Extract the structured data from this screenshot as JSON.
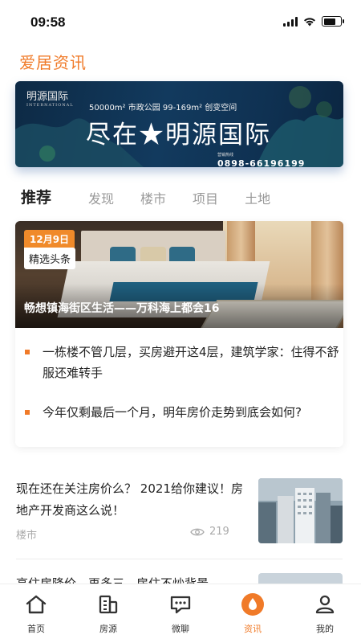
{
  "status": {
    "time": "09:58"
  },
  "header": {
    "title": "爱居资讯"
  },
  "banner": {
    "logo": "明源国际",
    "logo_en": "INTERNATIONAL",
    "sub": "50000m² 市政公园  99-169m² 创变空间",
    "main": "尽在★明源国际",
    "hotline_label": "营销热线",
    "phone": "0898-66196199"
  },
  "tabs": [
    {
      "label": "推荐",
      "active": true
    },
    {
      "label": "发现"
    },
    {
      "label": "楼市"
    },
    {
      "label": "项目"
    },
    {
      "label": "土地"
    }
  ],
  "featured": {
    "date": "12月9日",
    "badge": "精选头条",
    "title": "畅想镇海街区生活——万科海上都会16",
    "headlines": [
      "一栋楼不管几层，买房避开这4层，建筑学家：住得不舒服还难转手",
      "今年仅剩最后一个月，明年房价走势到底会如何?"
    ]
  },
  "articles": [
    {
      "title": "现在还在关注房价么？ 2021给你建议！房地产开发商这么说！",
      "tag": "楼市",
      "views": "219"
    },
    {
      "title": "高住房降价，再多三，房住不炒背景"
    }
  ],
  "tabbar": [
    {
      "label": "首页",
      "icon": "home-icon"
    },
    {
      "label": "房源",
      "icon": "building-icon"
    },
    {
      "label": "微聊",
      "icon": "chat-icon"
    },
    {
      "label": "资讯",
      "icon": "news-icon",
      "active": true
    },
    {
      "label": "我的",
      "icon": "user-icon"
    }
  ],
  "colors": {
    "accent": "#f07a28",
    "text": "#222222",
    "muted": "#999999"
  }
}
